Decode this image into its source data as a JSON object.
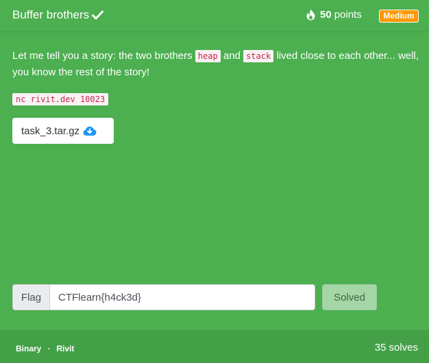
{
  "challenge": {
    "title": "Buffer brothers",
    "points_value": "50",
    "points_label": "points",
    "difficulty": "Medium"
  },
  "description": {
    "part1": "Let me tell you a story: the two brothers ",
    "code1": "heap",
    "part2": " and ",
    "code2": "stack",
    "part3": " lived close to each other... well, you know the rest of the story!"
  },
  "command": "nc rivit.dev 10023",
  "file": {
    "name": "task_3.tar.gz"
  },
  "flag_form": {
    "label": "Flag",
    "value": "CTFlearn{h4ck3d}",
    "submit_label": "Solved"
  },
  "footer": {
    "category": "Binary",
    "separator": "·",
    "author": "Rivit",
    "solves_count": "35",
    "solves_label": "solves"
  },
  "colors": {
    "background": "#4caf50",
    "badge": "#ff9800",
    "code_text": "#c7254e",
    "download_icon": "#2196f3"
  },
  "icons": {
    "solved": "check-icon",
    "points": "fire-icon",
    "download": "cloud-download-icon"
  }
}
